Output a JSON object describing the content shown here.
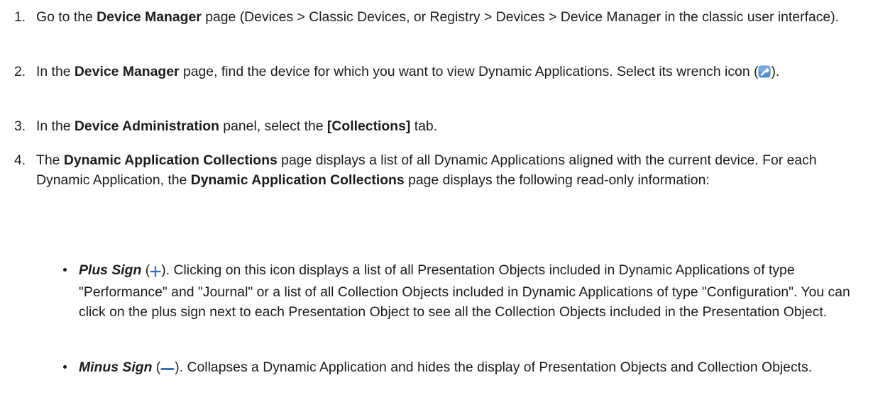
{
  "steps": [
    {
      "number": "1.",
      "text1": "Go to the ",
      "bold1": "Device Manager",
      "text2": " page (Devices > Classic Devices, or Registry > Devices > Device Manager in the classic user interface)."
    },
    {
      "number": "2.",
      "text1": "In the ",
      "bold1": "Device Manager",
      "text2": " page, find the device for which you want to view Dynamic Applications. Select its wrench icon (",
      "text3": ")."
    },
    {
      "number": "3.",
      "text1": "In the ",
      "bold1": "Device Administration",
      "text2": " panel, select the ",
      "bold2": "[Collections]",
      "text3": " tab."
    },
    {
      "number": "4.",
      "text1": "The ",
      "bold1": "Dynamic Application Collections",
      "text2": " page displays a list of all Dynamic Applications aligned with the current device. For each Dynamic Application, the ",
      "bold2": "Dynamic Application Collections",
      "text3": " page displays the following read-only information:"
    }
  ],
  "bullets": [
    {
      "term": "Plus Sign",
      "open": " (",
      "close": "). Clicking on this icon displays a list of all Presentation Objects included in Dynamic Applications of type \"Performance\" and \"Journal\" or a list of all Collection Objects included in Dynamic Applications of type \"Configuration\". You can click on the plus sign next to each Presentation Object to see all the Collection Objects included in the Presentation Object."
    },
    {
      "term": "Minus Sign",
      "open": " (",
      "close": "). Collapses a Dynamic Application and hides the display of Presentation Objects and Collection Objects."
    }
  ],
  "icons": {
    "wrench": "wrench-icon",
    "plus": "plus-icon",
    "minus": "minus-icon"
  },
  "colors": {
    "text": "#1c1c1c",
    "icon_blue": "#3a6fb0",
    "wrench_bg": "#5b8fd2"
  }
}
